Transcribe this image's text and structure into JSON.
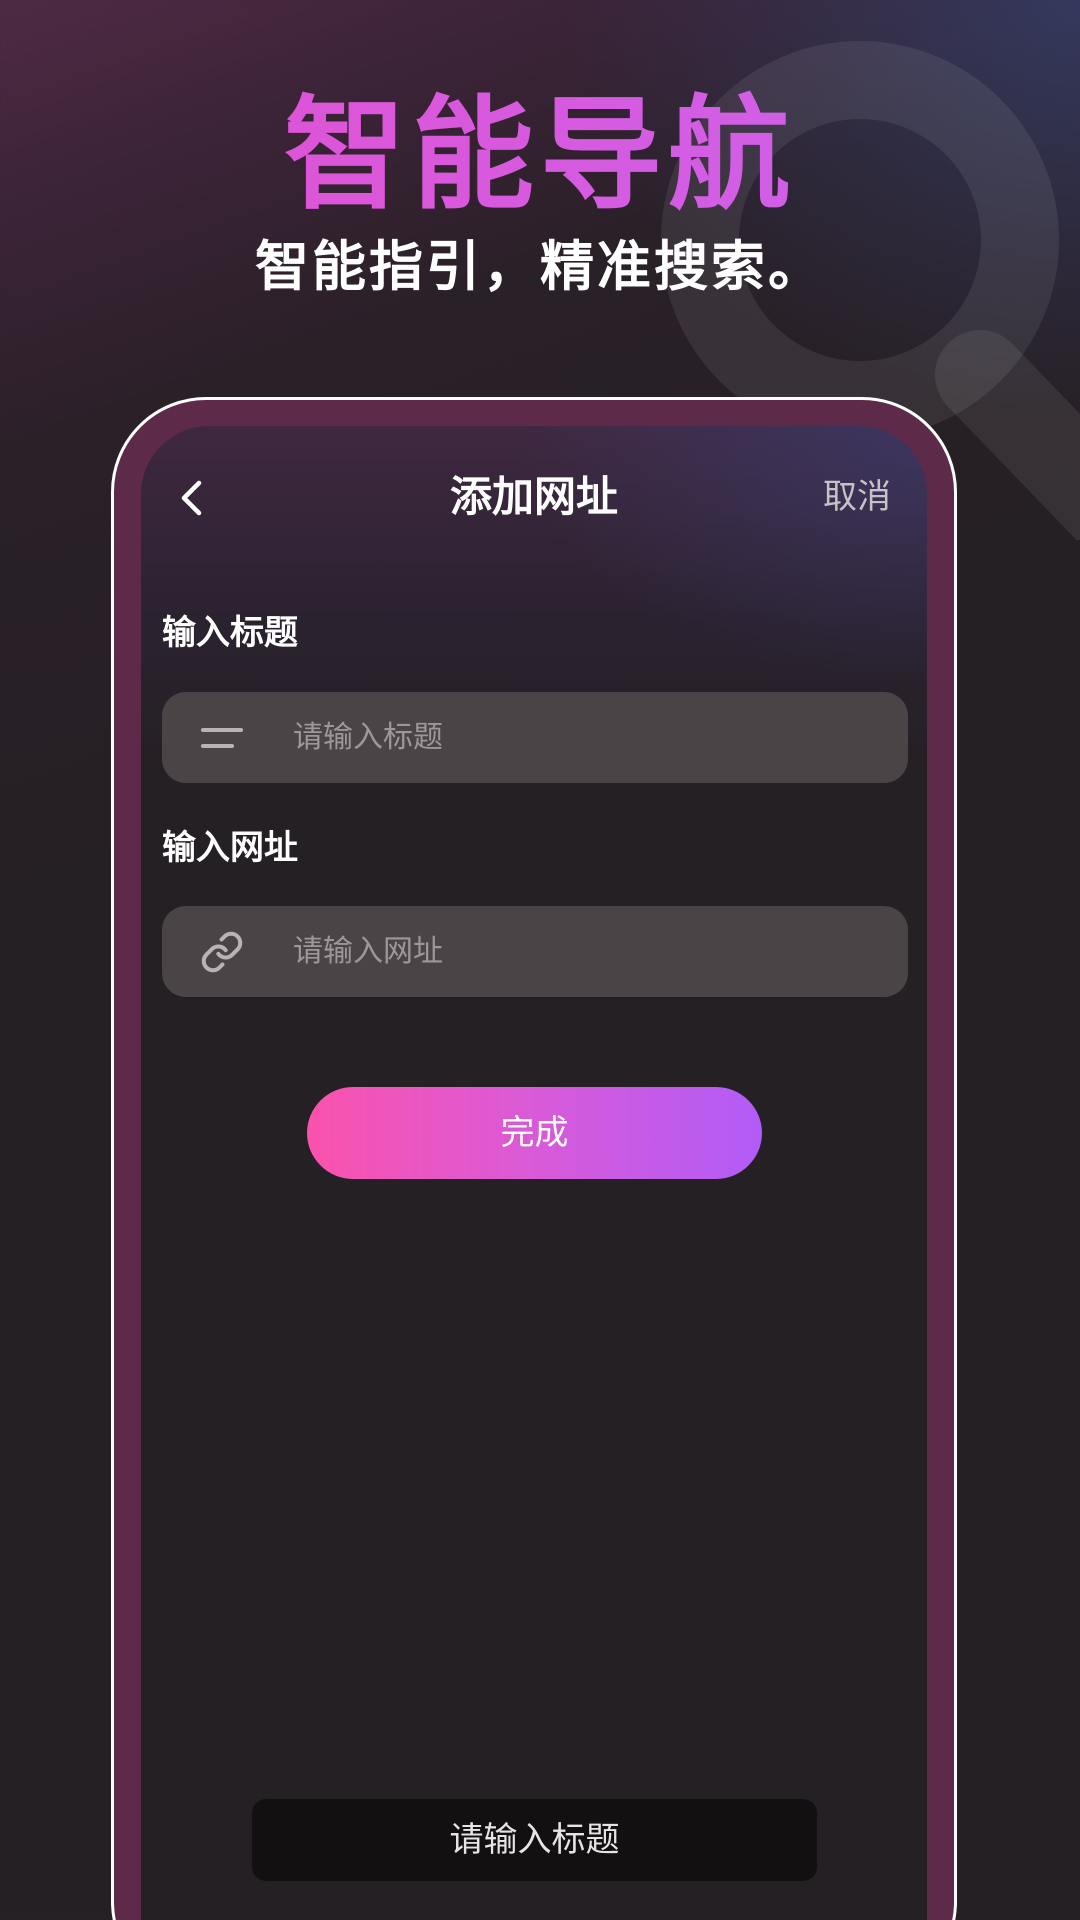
{
  "promo": {
    "headline": "智能导航",
    "subline": "智能指引，精准搜索。",
    "background_icon": "search-icon",
    "headline_gradient": [
      "#e44fcf",
      "#c965ee"
    ]
  },
  "screen": {
    "nav": {
      "back_icon": "chevron-left-icon",
      "title": "添加网址",
      "cancel_label": "取消"
    },
    "title_field": {
      "label": "输入标题",
      "icon": "lines-icon",
      "placeholder": "请输入标题"
    },
    "url_field": {
      "label": "输入网址",
      "icon": "link-icon",
      "placeholder": "请输入网址"
    },
    "done_button": {
      "label": "完成",
      "gradient": [
        "#fa52ac",
        "#b15cf7"
      ]
    },
    "toast": {
      "message": "请输入标题"
    }
  },
  "colors": {
    "background": "#252024",
    "phone_frame": "#5e2a4a",
    "input_bg": "#4a4446"
  }
}
